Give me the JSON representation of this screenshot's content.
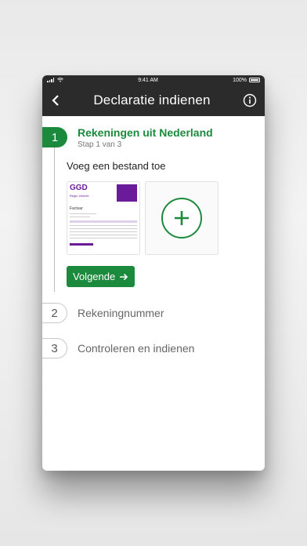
{
  "status_bar": {
    "time": "9:41 AM",
    "battery": "100%"
  },
  "header": {
    "title": "Declaratie indienen",
    "back_icon": "chevron-left-icon",
    "info_icon": "info-icon"
  },
  "steps": [
    {
      "number": "1",
      "title": "Rekeningen uit Nederland",
      "subtitle": "Stap 1 van 3",
      "state": "active"
    },
    {
      "number": "2",
      "title": "Rekeningnummer",
      "state": "inactive"
    },
    {
      "number": "3",
      "title": "Controleren en indienen",
      "state": "inactive"
    }
  ],
  "upload": {
    "label": "Voeg een bestand toe",
    "invoice_thumb": {
      "logo": "GGD",
      "logo_sub": "Regio Utrecht",
      "doc_title": "Factuur"
    },
    "add_icon": "plus-icon"
  },
  "next_button": {
    "label": "Volgende",
    "icon": "arrow-right-icon"
  },
  "colors": {
    "accent": "#1b8a3c",
    "appbar": "#2b2b2b",
    "brand_purple": "#6a1b9a"
  }
}
